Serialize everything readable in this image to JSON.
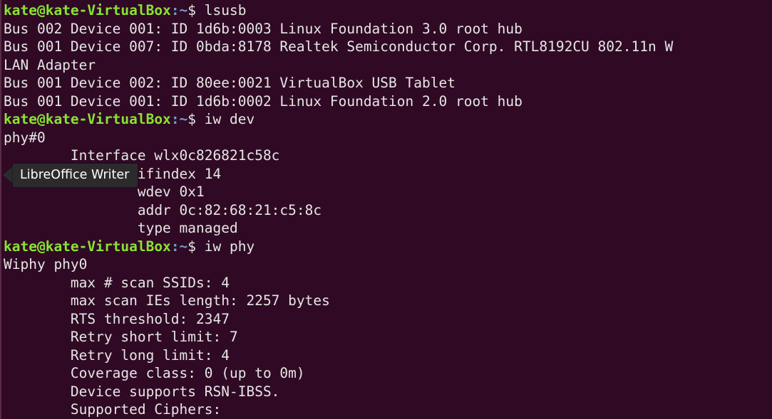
{
  "terminal": {
    "lines": [
      {
        "user": "kate@kate-VirtualBox",
        "path": ":~",
        "prompt": "$ ",
        "command": "lsusb"
      },
      {
        "text": "Bus 002 Device 001: ID 1d6b:0003 Linux Foundation 3.0 root hub"
      },
      {
        "text": "Bus 001 Device 007: ID 0bda:8178 Realtek Semiconductor Corp. RTL8192CU 802.11n W"
      },
      {
        "text": "LAN Adapter"
      },
      {
        "text": "Bus 001 Device 002: ID 80ee:0021 VirtualBox USB Tablet"
      },
      {
        "text": "Bus 001 Device 001: ID 1d6b:0002 Linux Foundation 2.0 root hub"
      },
      {
        "user": "kate@kate-VirtualBox",
        "path": ":~",
        "prompt": "$ ",
        "command": "iw dev"
      },
      {
        "text": "phy#0"
      },
      {
        "text": "        Interface wlx0c826821c58c"
      },
      {
        "text": "                ifindex 14"
      },
      {
        "text": "                wdev 0x1"
      },
      {
        "text": "                addr 0c:82:68:21:c5:8c"
      },
      {
        "text": "                type managed"
      },
      {
        "user": "kate@kate-VirtualBox",
        "path": ":~",
        "prompt": "$ ",
        "command": "iw phy"
      },
      {
        "text": "Wiphy phy0"
      },
      {
        "text": "        max # scan SSIDs: 4"
      },
      {
        "text": "        max scan IEs length: 2257 bytes"
      },
      {
        "text": "        RTS threshold: 2347"
      },
      {
        "text": "        Retry short limit: 7"
      },
      {
        "text": "        Retry long limit: 4"
      },
      {
        "text": "        Coverage class: 0 (up to 0m)"
      },
      {
        "text": "        Device supports RSN-IBSS."
      },
      {
        "text": "        Supported Ciphers:"
      }
    ]
  },
  "tooltip": {
    "label": "LibreOffice Writer"
  },
  "colors": {
    "background": "#300a24",
    "prompt_user": "#8ae234",
    "prompt_path": "#729fcf",
    "text": "#e6e6e6"
  }
}
